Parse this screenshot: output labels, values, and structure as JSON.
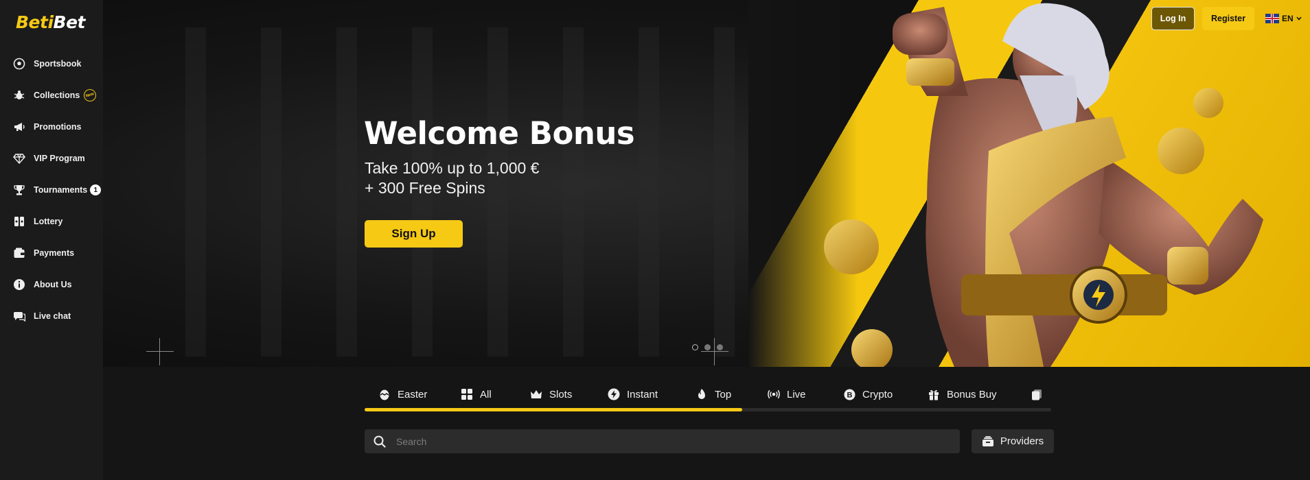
{
  "brand": {
    "logo_part1": "Beti",
    "logo_part2": "Bet"
  },
  "sidebar": {
    "items": [
      {
        "label": "Sportsbook",
        "icon": "soccer-ball-icon"
      },
      {
        "label": "Collections",
        "icon": "bug-icon",
        "badge": "New"
      },
      {
        "label": "Promotions",
        "icon": "megaphone-icon"
      },
      {
        "label": "VIP Program",
        "icon": "diamond-icon"
      },
      {
        "label": "Tournaments",
        "icon": "trophy-icon",
        "count": "1"
      },
      {
        "label": "Lottery",
        "icon": "lottery-ticket-icon"
      },
      {
        "label": "Payments",
        "icon": "wallet-icon"
      },
      {
        "label": "About Us",
        "icon": "info-icon"
      },
      {
        "label": "Live chat",
        "icon": "chat-icon"
      }
    ]
  },
  "header": {
    "login_label": "Log In",
    "register_label": "Register",
    "language": "EN"
  },
  "hero": {
    "title": "Welcome Bonus",
    "subtitle_line1": "Take 100% up to 1,000 €",
    "subtitle_line2": "+ 300 Free Spins",
    "cta_label": "Sign Up",
    "slides": 3,
    "active_slide": 1
  },
  "categories": {
    "tabs": [
      {
        "label": "Easter",
        "icon": "easter-egg-icon"
      },
      {
        "label": "All",
        "icon": "grid-icon"
      },
      {
        "label": "Slots",
        "icon": "crown-icon"
      },
      {
        "label": "Instant",
        "icon": "lightning-icon"
      },
      {
        "label": "Top",
        "icon": "fire-icon"
      },
      {
        "label": "Live",
        "icon": "broadcast-icon"
      },
      {
        "label": "Crypto",
        "icon": "bitcoin-icon"
      },
      {
        "label": "Bonus Buy",
        "icon": "gift-icon"
      },
      {
        "label": "",
        "icon": "cards-icon"
      }
    ],
    "scroll_progress": 0.55
  },
  "search": {
    "placeholder": "Search"
  },
  "providers": {
    "label": "Providers",
    "icon": "providers-icon"
  },
  "colors": {
    "accent": "#f6c915",
    "background": "#151515",
    "sidebar": "#1b1b1b",
    "input": "#2c2c2c"
  }
}
